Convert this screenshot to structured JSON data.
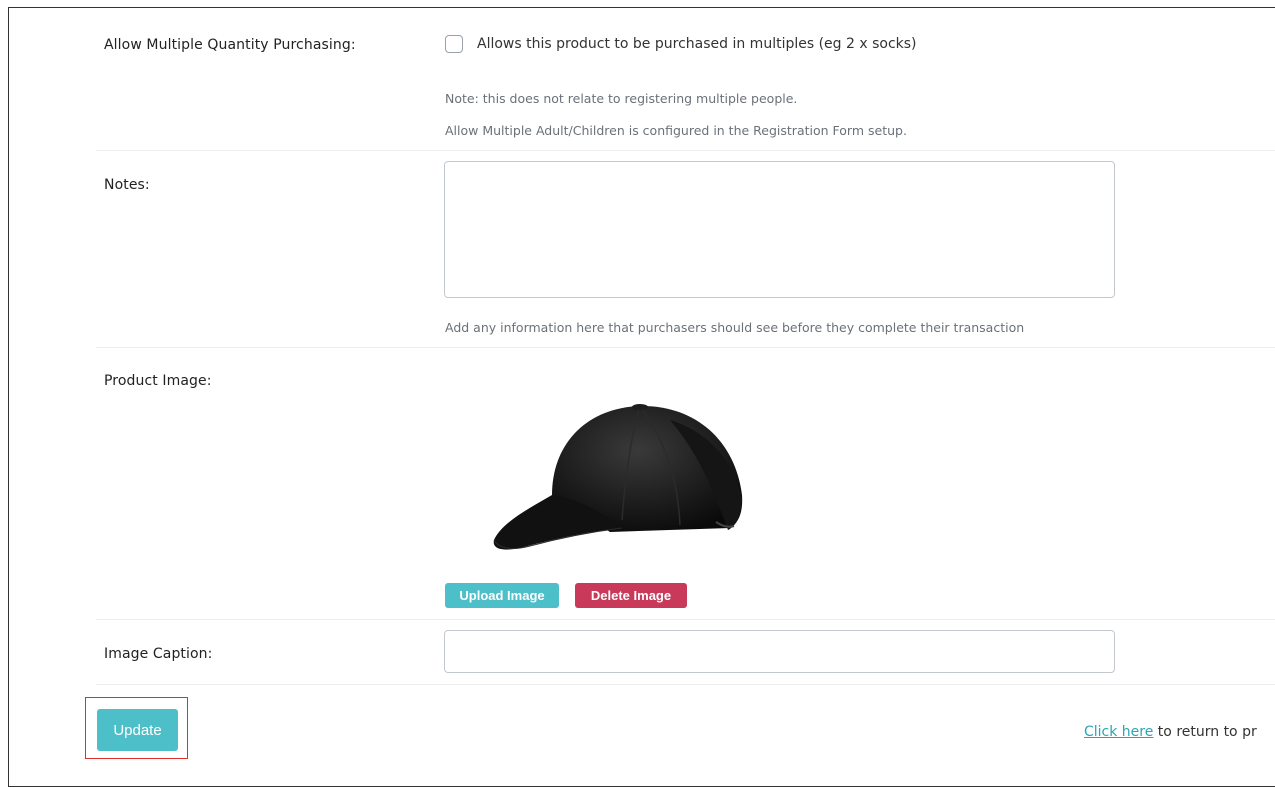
{
  "multiple_quantity": {
    "label": "Allow Multiple Quantity Purchasing:",
    "checkbox_text": "Allows this product to be purchased in multiples (eg 2 x socks)",
    "checked": false,
    "note_1": "Note: this does not relate to registering multiple people.",
    "note_2": "Allow Multiple Adult/Children is configured in the Registration Form setup."
  },
  "notes": {
    "label": "Notes:",
    "value": "",
    "help": "Add any information here that purchasers should see before they complete their transaction"
  },
  "product_image": {
    "label": "Product Image:",
    "image_subject": "black-baseball-cap",
    "upload_label": "Upload Image",
    "delete_label": "Delete Image"
  },
  "image_caption": {
    "label": "Image Caption:",
    "value": ""
  },
  "footer": {
    "update_label": "Update",
    "return_link": "Click here",
    "return_text": " to return to pr"
  },
  "colors": {
    "accent": "#4dbfc9",
    "danger": "#c8395a",
    "highlight": "#e0302c"
  }
}
